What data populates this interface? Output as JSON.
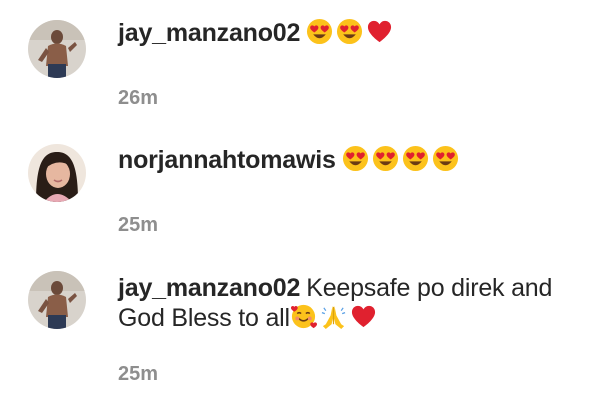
{
  "comments": [
    {
      "username": "jay_manzano02",
      "text": "",
      "emojis": [
        "heart-eyes-emoji",
        "heart-eyes-emoji",
        "red-heart-emoji"
      ],
      "time": "26m",
      "avatar": "avatar-man"
    },
    {
      "username": "norjannahtomawis",
      "text": "",
      "emojis": [
        "heart-eyes-emoji",
        "heart-eyes-emoji",
        "heart-eyes-emoji",
        "heart-eyes-emoji"
      ],
      "time": "25m",
      "avatar": "avatar-woman"
    },
    {
      "username": "jay_manzano02",
      "text": "Keepsafe po direk and God Bless to all",
      "emojis": [
        "smiling-face-with-hearts-emoji",
        "folded-hands-emoji",
        "red-heart-emoji"
      ],
      "time": "25m",
      "avatar": "avatar-man"
    }
  ],
  "colors": {
    "text": "#262626",
    "timestamp": "#8e8e8e",
    "heart": "#e0212f",
    "emoji_face": "#fcc21b"
  }
}
